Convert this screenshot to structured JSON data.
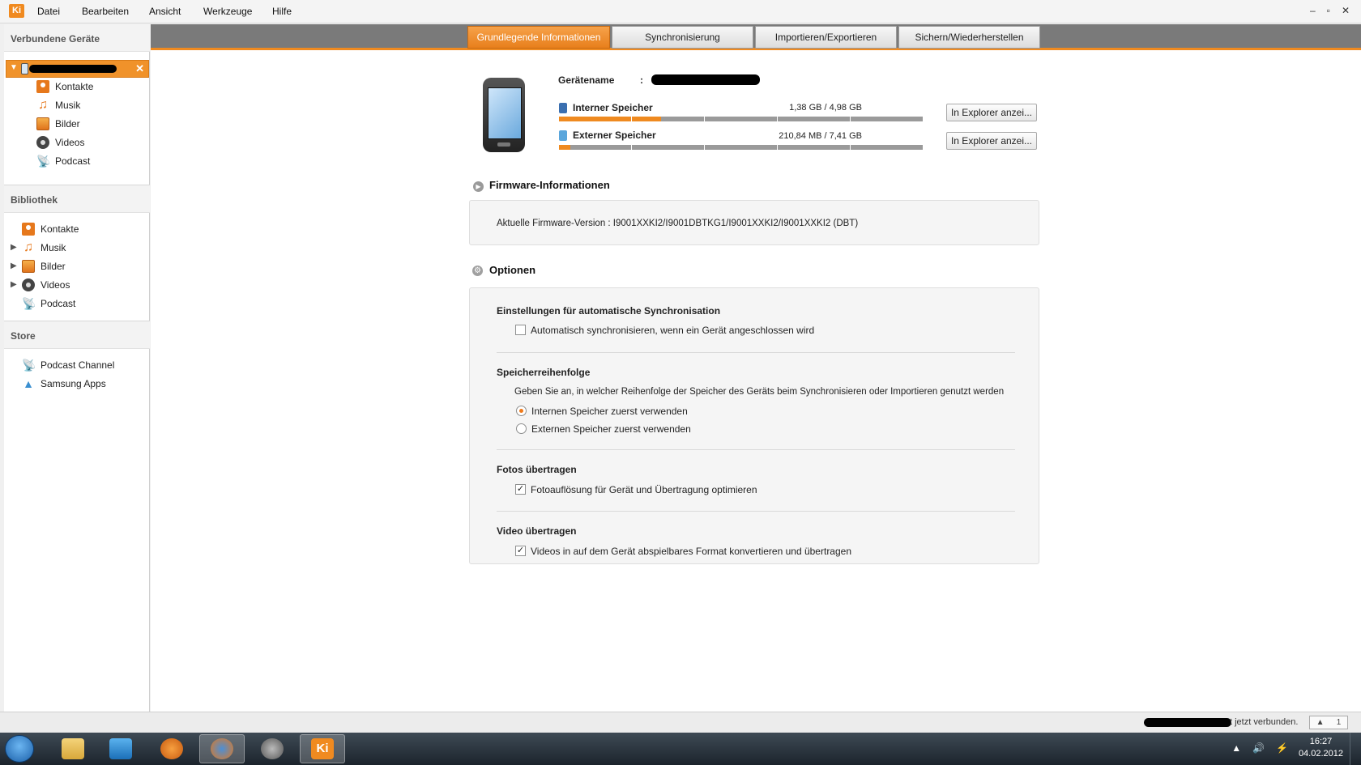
{
  "menubar": {
    "logo": "Ki",
    "items": [
      "Datei",
      "Bearbeiten",
      "Ansicht",
      "Werkzeuge",
      "Hilfe"
    ],
    "window_controls": [
      "–",
      "▫",
      "✕"
    ]
  },
  "sidebar": {
    "connected_header": "Verbundene Geräte",
    "device_items": [
      "Kontakte",
      "Musik",
      "Bilder",
      "Videos",
      "Podcast"
    ],
    "library_header": "Bibliothek",
    "library_items": [
      "Kontakte",
      "Musik",
      "Bilder",
      "Videos",
      "Podcast"
    ],
    "store_header": "Store",
    "store_items": [
      "Podcast Channel",
      "Samsung Apps"
    ]
  },
  "tabs": [
    {
      "label": "Grundlegende Informationen",
      "active": true
    },
    {
      "label": "Synchronisierung",
      "active": false
    },
    {
      "label": "Importieren/Exportieren",
      "active": false
    },
    {
      "label": "Sichern/Wiederherstellen",
      "active": false
    }
  ],
  "device_info": {
    "name_label": "Gerätename",
    "name_sep": ":",
    "internal_label": "Interner Speicher",
    "internal_value": "1,38 GB / 4,98 GB",
    "internal_fill": 0.28,
    "external_label": "Externer Speicher",
    "external_value": "210,84 MB / 7,41 GB",
    "external_fill": 0.03,
    "explorer_button": "In Explorer anzei..."
  },
  "firmware": {
    "title": "Firmware-Informationen",
    "text": "Aktuelle Firmware-Version : I9001XXKI2/I9001DBTKG1/I9001XXKI2/I9001XXKI2 (DBT)"
  },
  "options": {
    "title": "Optionen",
    "auto_sync_head": "Einstellungen für automatische Synchronisation",
    "auto_sync_check": "Automatisch synchronisieren, wenn ein Gerät angeschlossen wird",
    "auto_sync_checked": false,
    "storage_order_head": "Speicherreihenfolge",
    "storage_order_desc": "Geben Sie an, in welcher Reihenfolge der Speicher des Geräts beim Synchronisieren oder Importieren genutzt werden",
    "radio_internal": "Internen Speicher zuerst verwenden",
    "radio_external": "Externen Speicher zuerst verwenden",
    "photos_head": "Fotos übertragen",
    "photos_check": "Fotoauflösung für Gerät und Übertragung optimieren",
    "photos_checked": true,
    "video_head": "Video übertragen",
    "video_check": "Videos in auf dem Gerät abspielbares Format konvertieren und übertragen",
    "video_checked": true
  },
  "statusbar": {
    "text": "t jetzt verbunden.",
    "spinner_up": "▲",
    "spinner_value": "1"
  },
  "taskbar": {
    "tray_icons": [
      "▲",
      "🔊",
      "⚡"
    ],
    "time": "16:27",
    "date": "04.02.2012"
  }
}
